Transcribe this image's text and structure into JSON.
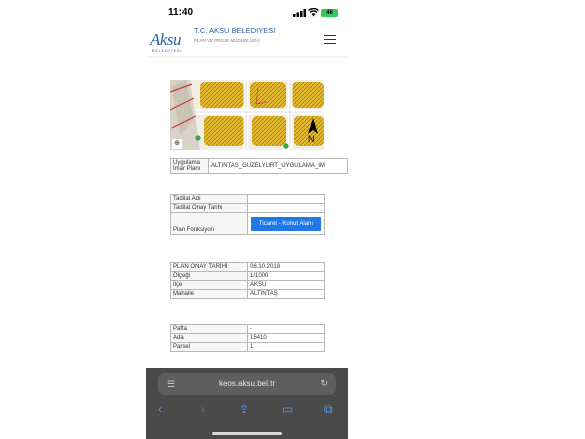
{
  "status_bar": {
    "time": "11:40",
    "battery": "46"
  },
  "header": {
    "logo_text": "Aksu",
    "logo_sub": "BELEDIYESI",
    "org_title": "T.C. AKSU BELEDIYESİ",
    "org_sub": "PLAN VE PROJE MÜDÜRLÜĞÜ"
  },
  "map": {
    "north_label": "N",
    "zoom_icon": "zoom-in-icon"
  },
  "plan_table": {
    "rows": [
      {
        "label": "Uygulama İmar Planı",
        "value": "ALTINTAS_GUZELYURT_UYGULAMA_IM"
      }
    ]
  },
  "revision_table": {
    "rows": [
      {
        "label": "Tadilat Adı",
        "value": ""
      },
      {
        "label": "Tadilat Onay Tarihi",
        "value": ""
      }
    ],
    "function_label": "Plan Fonksiyon",
    "function_button": "Ticaret - Konut Alanı"
  },
  "info_table": {
    "rows": [
      {
        "label": "PLAN ONAY TARİHİ",
        "value": "08.10.2018"
      },
      {
        "label": "Ölçeği",
        "value": "1/1000"
      },
      {
        "label": "İlçe",
        "value": "AKSU"
      },
      {
        "label": "Mahalle",
        "value": "ALTINTAŞ"
      }
    ]
  },
  "parcel_table": {
    "rows": [
      {
        "label": "Pafta",
        "value": "-"
      },
      {
        "label": "Ada",
        "value": "15410"
      },
      {
        "label": "Parsel",
        "value": "1"
      }
    ]
  },
  "browser": {
    "url": "keos.aksu.bel.tr"
  },
  "colors": {
    "brand": "#2c5fa8",
    "button": "#1e78e6",
    "toolbar": "#4a4a4a",
    "accent": "#4a9ef8"
  }
}
